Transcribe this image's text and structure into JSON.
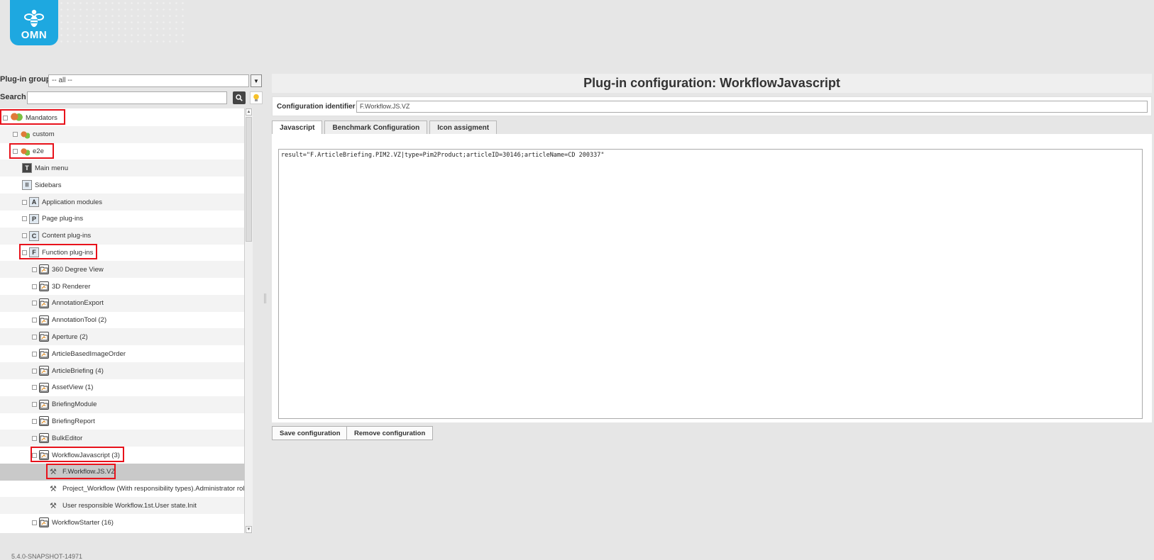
{
  "brand": {
    "logo_text": "OMN"
  },
  "left": {
    "plugin_group_label": "Plug-in group",
    "plugin_group_value": "-- all --",
    "search_label": "Search",
    "search_value": ""
  },
  "tree": [
    {
      "label": "Mandators",
      "level": 0,
      "icon": "group-icon",
      "expander": true
    },
    {
      "label": "custom",
      "level": 1,
      "icon": "mandator-icon",
      "expander": true
    },
    {
      "label": "e2e",
      "level": 1,
      "icon": "mandator-icon",
      "expander": true
    },
    {
      "label": "Main menu",
      "level": 2,
      "icon": "main-menu-icon",
      "expander": false
    },
    {
      "label": "Sidebars",
      "level": 2,
      "icon": "sidebars-icon",
      "expander": false
    },
    {
      "label": "Application modules",
      "level": 2,
      "icon": "letter-a-icon",
      "expander": true
    },
    {
      "label": "Page plug-ins",
      "level": 2,
      "icon": "letter-p-icon",
      "expander": true
    },
    {
      "label": "Content plug-ins",
      "level": 2,
      "icon": "letter-c-icon",
      "expander": true
    },
    {
      "label": "Function plug-ins",
      "level": 2,
      "icon": "letter-f-icon",
      "expander": true
    },
    {
      "label": "360 Degree View",
      "level": 3,
      "icon": "plugin-folder-icon",
      "expander": true
    },
    {
      "label": "3D Renderer",
      "level": 3,
      "icon": "plugin-folder-icon",
      "expander": true
    },
    {
      "label": "AnnotationExport",
      "level": 3,
      "icon": "plugin-folder-icon",
      "expander": true
    },
    {
      "label": "AnnotationTool (2)",
      "level": 3,
      "icon": "plugin-folder-icon",
      "expander": true
    },
    {
      "label": "Aperture (2)",
      "level": 3,
      "icon": "plugin-folder-icon",
      "expander": true
    },
    {
      "label": "ArticleBasedImageOrder",
      "level": 3,
      "icon": "plugin-folder-icon",
      "expander": true
    },
    {
      "label": "ArticleBriefing (4)",
      "level": 3,
      "icon": "plugin-folder-icon",
      "expander": true
    },
    {
      "label": "AssetView (1)",
      "level": 3,
      "icon": "plugin-folder-icon",
      "expander": true
    },
    {
      "label": "BriefingModule",
      "level": 3,
      "icon": "plugin-folder-icon",
      "expander": true
    },
    {
      "label": "BriefingReport",
      "level": 3,
      "icon": "plugin-folder-icon",
      "expander": true
    },
    {
      "label": "BulkEditor",
      "level": 3,
      "icon": "plugin-folder-icon",
      "expander": true
    },
    {
      "label": "WorkflowJavascript (3)",
      "level": 3,
      "icon": "plugin-folder-icon",
      "expander": true
    },
    {
      "label": "F.Workflow.JS.VZ",
      "level": 4,
      "icon": "wrench-icon",
      "expander": false
    },
    {
      "label": "Project_Workflow (With responsibility types).Administrator role state.Ini",
      "level": 4,
      "icon": "wrench-icon",
      "expander": false
    },
    {
      "label": "User responsible Workflow.1st.User state.Init",
      "level": 4,
      "icon": "wrench-icon",
      "expander": false
    },
    {
      "label": "WorkflowStarter (16)",
      "level": 3,
      "icon": "plugin-folder-icon",
      "expander": true
    }
  ],
  "right": {
    "title": "Plug-in configuration: WorkflowJavascript",
    "config_id_label": "Configuration identifier",
    "config_id_value": "F.Workflow.JS.VZ",
    "tabs": [
      "Javascript",
      "Benchmark Configuration",
      "Icon assigment"
    ],
    "active_tab": "Javascript",
    "code": "result=\"F.ArticleBriefing.PIM2.VZ|type=Pim2Product;articleID=30146;articleName=CD 200337\"",
    "save_button": "Save configuration",
    "remove_button": "Remove configuration"
  },
  "footer": {
    "version": "5.4.0-SNAPSHOT-14971"
  },
  "colors": {
    "highlight": "#e8121b",
    "brand": "#1ea8e0",
    "selected_row": "#c9c9c9"
  }
}
